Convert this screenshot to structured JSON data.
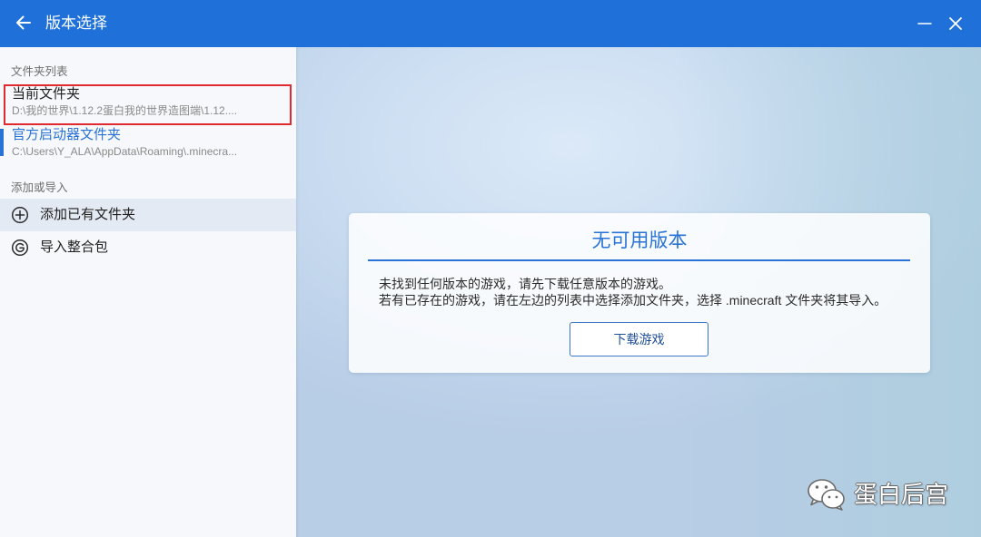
{
  "colors": {
    "titlebar": "#1f71d9",
    "accent": "#2a73d6",
    "annotation": "#e02a2f"
  },
  "window": {
    "title": "版本选择",
    "back_icon": "arrow-left-icon",
    "minimize_icon": "minimize-icon",
    "close_icon": "close-icon"
  },
  "sidebar": {
    "folders_header": "文件夹列表",
    "folders": [
      {
        "label": "当前文件夹",
        "path": "D:\\我的世界\\1.12.2蛋白我的世界造图端\\1.12....",
        "selected": false
      },
      {
        "label": "官方启动器文件夹",
        "path": "C:\\Users\\Y_ALA\\AppData\\Roaming\\.minecra...",
        "selected": true
      }
    ],
    "actions_header": "添加或导入",
    "actions": [
      {
        "label": "添加已有文件夹",
        "icon": "plus-circle-icon",
        "hovered": true
      },
      {
        "label": "导入整合包",
        "icon": "modpack-icon",
        "hovered": false
      }
    ]
  },
  "main": {
    "empty_card": {
      "title": "无可用版本",
      "lines": [
        "未找到任何版本的游戏，请先下载任意版本的游戏。",
        "若有已存在的游戏，请在左边的列表中选择添加文件夹，选择 .minecraft 文件夹将其导入。"
      ],
      "download_button": "下载游戏"
    }
  },
  "watermark": {
    "icon": "wechat-icon",
    "text": "蛋白后宫"
  }
}
